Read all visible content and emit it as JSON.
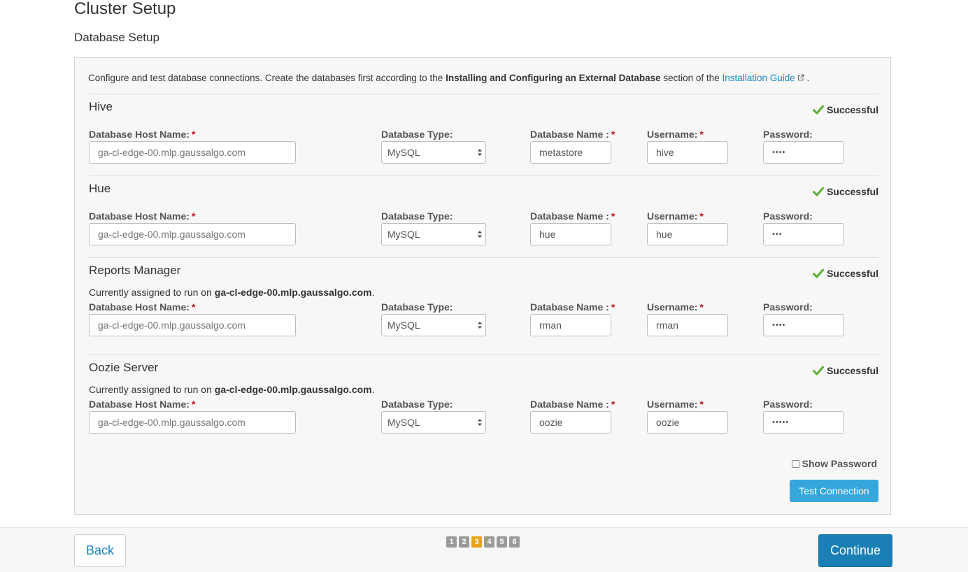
{
  "page": {
    "title": "Cluster Setup",
    "section": "Database Setup"
  },
  "intro": {
    "prefix": "Configure and test database connections. Create the databases first according to the ",
    "bold": "Installing and Configuring an External Database",
    "middle": " section of the ",
    "link": "Installation Guide",
    "suffix": " ."
  },
  "labels": {
    "host": "Database Host Name:",
    "type": "Database Type:",
    "dbname": "Database Name :",
    "username": "Username:",
    "password": "Password:",
    "required": "*",
    "assigned_prefix": "Currently assigned to run on ",
    "status": "Successful"
  },
  "services": [
    {
      "name": "Hive",
      "assigned_host": "",
      "host": "ga-cl-edge-00.mlp.gaussalgo.com",
      "type": "MySQL",
      "dbname": "metastore",
      "username": "hive",
      "password": "••••"
    },
    {
      "name": "Hue",
      "assigned_host": "",
      "host": "ga-cl-edge-00.mlp.gaussalgo.com",
      "type": "MySQL",
      "dbname": "hue",
      "username": "hue",
      "password": "•••"
    },
    {
      "name": "Reports Manager",
      "assigned_host": "ga-cl-edge-00.mlp.gaussalgo.com",
      "host": "ga-cl-edge-00.mlp.gaussalgo.com",
      "type": "MySQL",
      "dbname": "rman",
      "username": "rman",
      "password": "••••"
    },
    {
      "name": "Oozie Server",
      "assigned_host": "ga-cl-edge-00.mlp.gaussalgo.com",
      "host": "ga-cl-edge-00.mlp.gaussalgo.com",
      "type": "MySQL",
      "dbname": "oozie",
      "username": "oozie",
      "password": "•••••"
    }
  ],
  "show_password": {
    "label": "Show Password",
    "checked": false
  },
  "buttons": {
    "test": "Test Connection",
    "back": "Back",
    "continue": "Continue"
  },
  "steps": {
    "items": [
      "1",
      "2",
      "3",
      "4",
      "5",
      "6"
    ],
    "current": "3"
  },
  "colors": {
    "success": "#5cb030",
    "link": "#1a87c1",
    "required": "#b71c1c",
    "primary": "#1a7fb5",
    "step_active": "#e8a317"
  }
}
